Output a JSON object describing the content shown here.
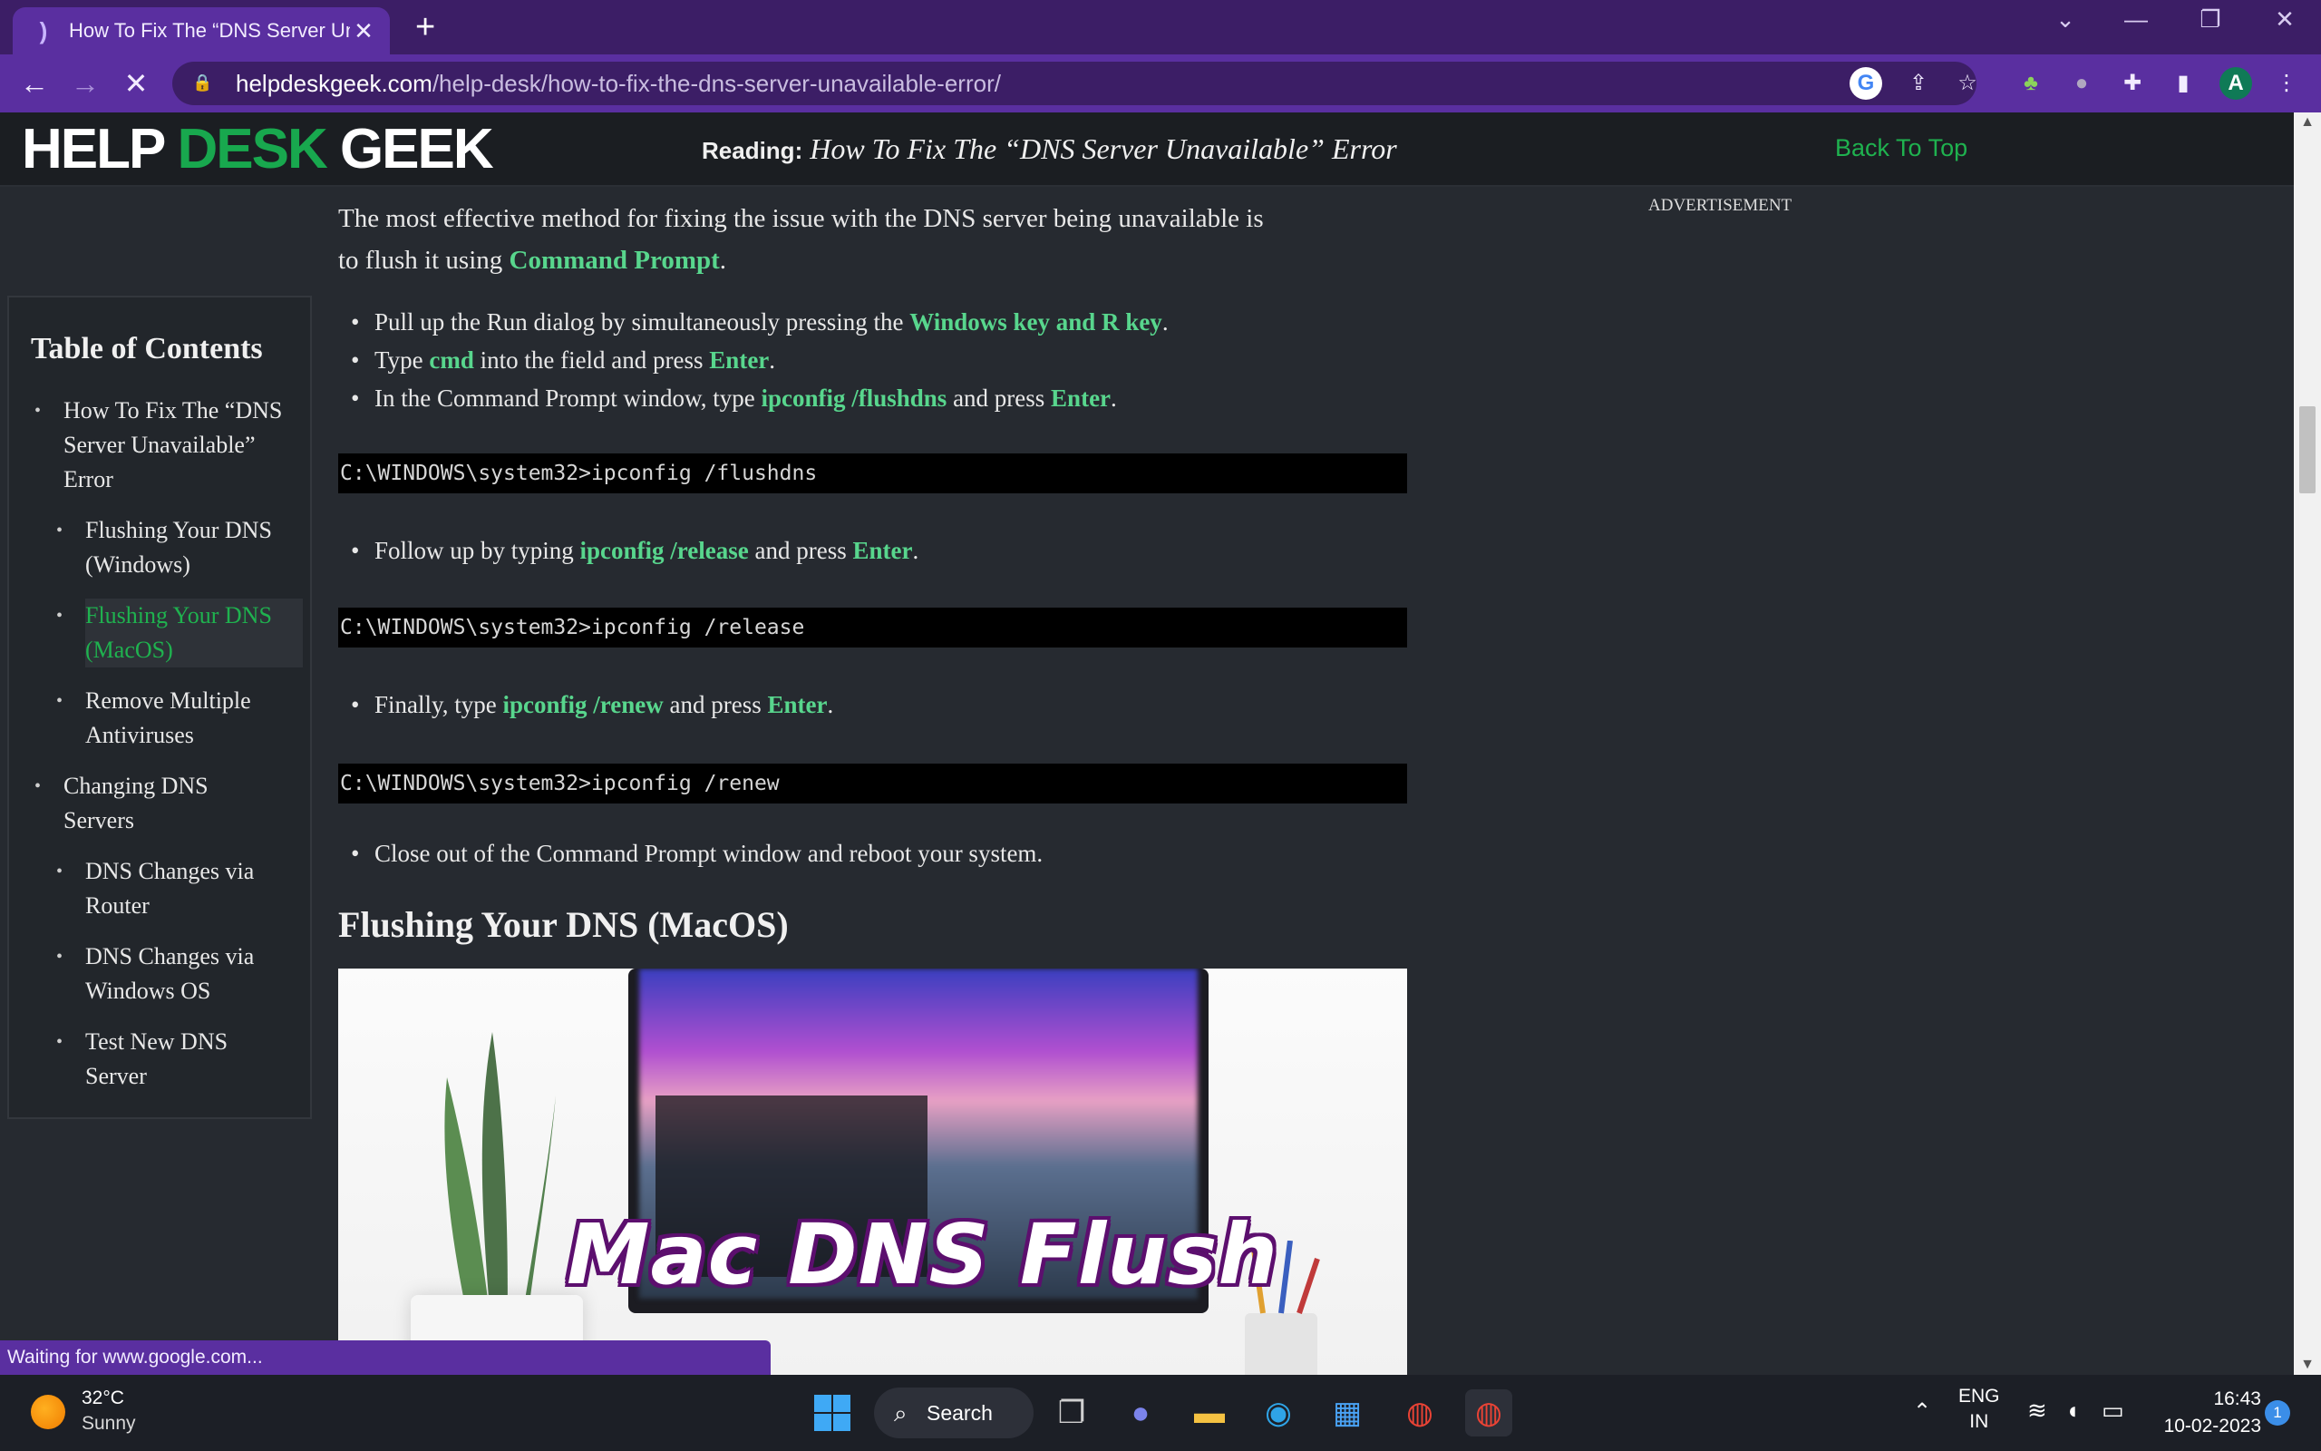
{
  "browser": {
    "tab_title": "How To Fix The “DNS Server Unav",
    "tab_close": "✕",
    "new_tab": "+",
    "url_domain": "helpdeskgeek.com",
    "url_path": "/help-desk/how-to-fix-the-dns-server-unavailable-error/",
    "profile_initial": "A",
    "accent_color": "#5a2fa0"
  },
  "site": {
    "logo_part1": "HELP ",
    "logo_part2": "DESK",
    "logo_part3": " GEEK",
    "reading_label": "Reading:",
    "reading_title": "How To Fix The “DNS Server Unavailable” Error",
    "back_to_top": "Back To Top",
    "advertisement": "ADVERTISEMENT",
    "brand_color": "#18a84e"
  },
  "toc": {
    "title": "Table of Contents",
    "items": [
      {
        "label_line1": "How To Fix The “DNS",
        "label_line2": "Server Unavailable”",
        "label_line3": "Error"
      },
      {
        "label_line1": "Flushing Your DNS",
        "label_line2": "(Windows)"
      },
      {
        "label_line1": "Flushing Your DNS",
        "label_line2": "(MacOS)"
      },
      {
        "label_line1": "Remove Multiple",
        "label_line2": "Antiviruses"
      },
      {
        "label_line1": "Changing DNS",
        "label_line2": "Servers"
      },
      {
        "label_line1": "DNS Changes via",
        "label_line2": "Router"
      },
      {
        "label_line1": "DNS Changes via",
        "label_line2": "Windows OS"
      },
      {
        "label_line1": "Test New DNS",
        "label_line2": "Server"
      }
    ]
  },
  "article": {
    "intro_1": "The most effective method for fixing the issue with the DNS server being unavailable is",
    "intro_2": "to flush it using ",
    "intro_link": "Command Prompt",
    "intro_end": ".",
    "b1_text": "Pull up the Run dialog by simultaneously pressing the ",
    "b1_hl": "Windows key and R key",
    "b2_text1": "Type ",
    "b2_hl1": "cmd",
    "b2_text2": " into the field and press ",
    "b2_hl2": "Enter",
    "b3_text1": "In the Command Prompt window, type ",
    "b3_hl1": "ipconfig /flushdns",
    "b3_text2": " and press ",
    "b3_hl2": "Enter",
    "code1": "C:\\WINDOWS\\system32>ipconfig /flushdns",
    "b4_text1": "Follow up by typing ",
    "b4_hl1": "ipconfig /release",
    "b4_text2": " and press ",
    "b4_hl2": "Enter",
    "code2": "C:\\WINDOWS\\system32>ipconfig /release",
    "b5_text1": "Finally, type ",
    "b5_hl1": "ipconfig /renew",
    "b5_text2": " and press ",
    "b5_hl2": "Enter",
    "code3": "C:\\WINDOWS\\system32>ipconfig /renew",
    "b6_text": "Close out of the Command Prompt window and reboot your system.",
    "heading": "Flushing Your DNS (MacOS)",
    "hero_text": "Mac DNS Flush",
    "period": "."
  },
  "status_tip": "Waiting for www.google.com...",
  "taskbar": {
    "temperature": "32°C",
    "condition": "Sunny",
    "search_label": "Search",
    "lang_line1": "ENG",
    "lang_line2": "IN",
    "time": "16:43",
    "date": "10-02-2023",
    "notifications": "1"
  }
}
